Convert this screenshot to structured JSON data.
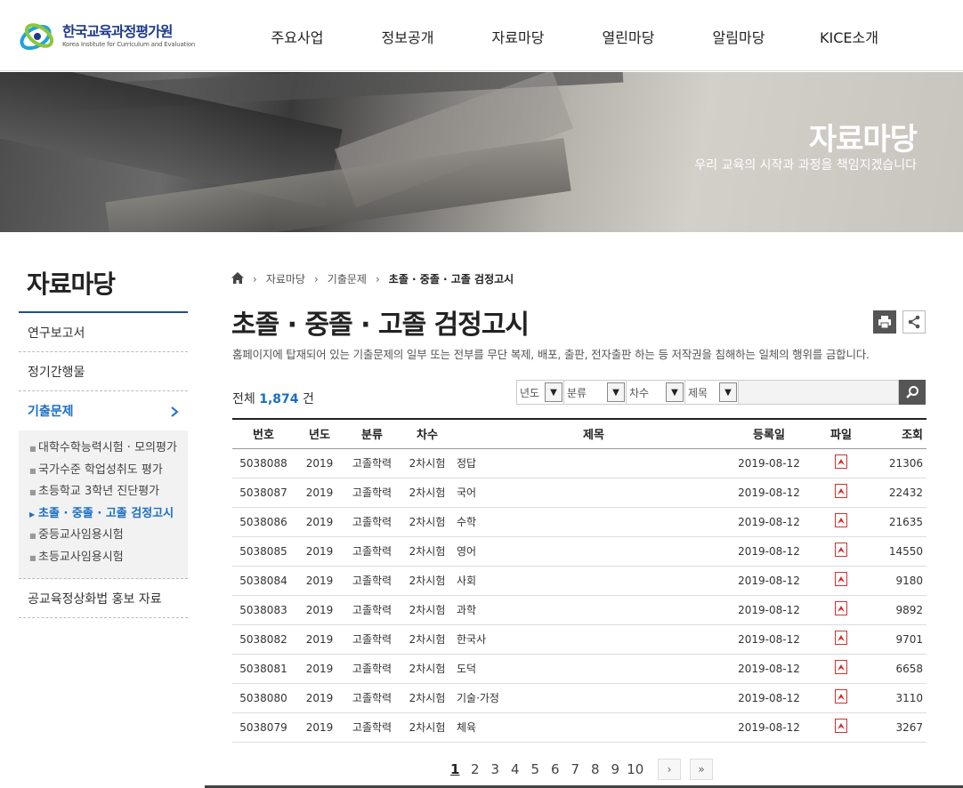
{
  "header": {
    "logo_ko": "한국교육과정평가원",
    "logo_en": "Korea Institute for Curriculum and Evaluation",
    "nav": [
      "주요사업",
      "정보공개",
      "자료마당",
      "열린마당",
      "알림마당",
      "KICE소개"
    ]
  },
  "banner": {
    "title": "자료마당",
    "subtitle": "우리 교육의 시작과 과정을 책임지겠습니다"
  },
  "sidebar": {
    "title": "자료마당",
    "items": [
      {
        "label": "연구보고서"
      },
      {
        "label": "정기간행물"
      },
      {
        "label": "기출문제"
      },
      {
        "label": "공교육정상화법 홍보 자료"
      }
    ],
    "sub_items": [
      {
        "label": "대학수학능력시험 · 모의평가"
      },
      {
        "label": "국가수준 학업성취도 평가"
      },
      {
        "label": "초등학교 3학년 진단평가"
      },
      {
        "label": "초졸 · 중졸 · 고졸 검정고시"
      },
      {
        "label": "중등교사임용시험"
      },
      {
        "label": "초등교사임용시험"
      }
    ]
  },
  "breadcrumb": [
    "자료마당",
    "기출문제",
    "초졸 · 중졸 · 고졸 검정고시"
  ],
  "page": {
    "title": "초졸 · 중졸 · 고졸 검정고시",
    "notice": "홈페이지에 탑재되어 있는 기출문제의 일부 또는 전부를 무단 복제, 배포, 출판, 전자출판 하는 등 저작권을 침해하는 일체의 행위를 금합니다.",
    "total_prefix": "전체",
    "total_count": "1,874",
    "total_suffix": "건"
  },
  "search": {
    "filters": [
      "년도",
      "분류",
      "차수",
      "제목"
    ],
    "input_value": ""
  },
  "table": {
    "headers": [
      "번호",
      "년도",
      "분류",
      "차수",
      "제목",
      "등록일",
      "파일",
      "조회"
    ],
    "rows": [
      {
        "no": "5038088",
        "year": "2019",
        "category": "고졸학력",
        "round": "2차시험",
        "title": "정답",
        "date": "2019-08-12",
        "views": "21306"
      },
      {
        "no": "5038087",
        "year": "2019",
        "category": "고졸학력",
        "round": "2차시험",
        "title": "국어",
        "date": "2019-08-12",
        "views": "22432"
      },
      {
        "no": "5038086",
        "year": "2019",
        "category": "고졸학력",
        "round": "2차시험",
        "title": "수학",
        "date": "2019-08-12",
        "views": "21635"
      },
      {
        "no": "5038085",
        "year": "2019",
        "category": "고졸학력",
        "round": "2차시험",
        "title": "영어",
        "date": "2019-08-12",
        "views": "14550"
      },
      {
        "no": "5038084",
        "year": "2019",
        "category": "고졸학력",
        "round": "2차시험",
        "title": "사회",
        "date": "2019-08-12",
        "views": "9180"
      },
      {
        "no": "5038083",
        "year": "2019",
        "category": "고졸학력",
        "round": "2차시험",
        "title": "과학",
        "date": "2019-08-12",
        "views": "9892"
      },
      {
        "no": "5038082",
        "year": "2019",
        "category": "고졸학력",
        "round": "2차시험",
        "title": "한국사",
        "date": "2019-08-12",
        "views": "9701"
      },
      {
        "no": "5038081",
        "year": "2019",
        "category": "고졸학력",
        "round": "2차시험",
        "title": "도덕",
        "date": "2019-08-12",
        "views": "6658"
      },
      {
        "no": "5038080",
        "year": "2019",
        "category": "고졸학력",
        "round": "2차시험",
        "title": "기술·가정",
        "date": "2019-08-12",
        "views": "3110"
      },
      {
        "no": "5038079",
        "year": "2019",
        "category": "고졸학력",
        "round": "2차시험",
        "title": "체육",
        "date": "2019-08-12",
        "views": "3267"
      }
    ]
  },
  "pagination": {
    "pages": [
      "1",
      "2",
      "3",
      "4",
      "5",
      "6",
      "7",
      "8",
      "9",
      "10"
    ],
    "current": "1",
    "next": "›",
    "last": "»"
  },
  "colors": {
    "accent": "#1a6fc4",
    "brand": "#1d3a8a",
    "dark": "#555555"
  },
  "icons": [
    "home-icon",
    "chevron-right-icon",
    "print-icon",
    "share-icon",
    "search-icon",
    "pdf-icon",
    "chevron-down-icon"
  ]
}
